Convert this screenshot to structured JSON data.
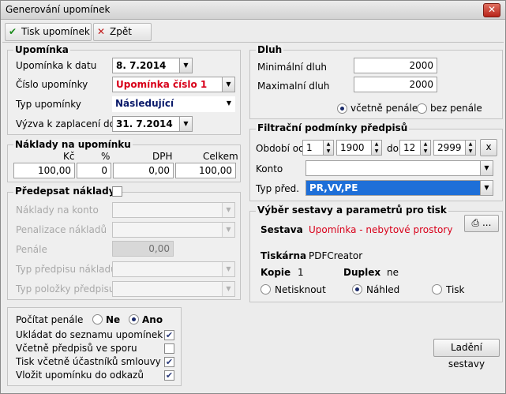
{
  "window": {
    "title": "Generování upomínek",
    "close": "✕"
  },
  "toolbar": {
    "print_label": "Tisk upomínek",
    "print_icon": "✔",
    "back_label": "Zpět",
    "back_icon": "✕"
  },
  "upominka": {
    "legend": "Upomínka",
    "date_label": "Upomínka k datu",
    "date_value": "8. 7.2014",
    "number_label": "Číslo upomínky",
    "number_value": "Upomínka číslo 1",
    "type_label": "Typ upomínky",
    "type_value": "Následující",
    "due_label": "Výzva k zaplacení do",
    "due_value": "31. 7.2014"
  },
  "naklady": {
    "legend": "Náklady na upomínku",
    "col_kc": "Kč",
    "col_pct": "%",
    "col_dph": "DPH",
    "col_celkem": "Celkem",
    "val_kc": "100,00",
    "val_pct": "0",
    "val_dph": "0,00",
    "val_celkem": "100,00"
  },
  "predepsat": {
    "legend": "Předepsat náklady",
    "konto_label": "Náklady na konto",
    "penal_label": "Penalizace nákladů",
    "penale_label": "Penále",
    "penale_value": "0,00",
    "typ_predpisu_label": "Typ předpisu nákladu",
    "typ_polozky_label": "Typ položky předpisu"
  },
  "options": {
    "pocitat_label": "Počítat penále",
    "ne_label": "Ne",
    "ano_label": "Ano",
    "ukladat_label": "Ukládat do seznamu upomínek",
    "ukladat": true,
    "vcetne_spor_label": "Včetně předpisů ve sporu",
    "vcetne_spor": false,
    "tisk_ucastniku_label": "Tisk včetně účastníků smlouvy",
    "tisk_ucastniku": true,
    "odkazy_label": "Vložit upomínku do odkazů",
    "odkazy": true
  },
  "dluh": {
    "legend": "Dluh",
    "min_label": "Minimální dluh",
    "min_value": "2000",
    "max_label": "Maximalní dluh",
    "max_value": "2000",
    "incl_label": "včetně penále",
    "excl_label": "bez penále"
  },
  "filtr": {
    "legend": "Filtrační podmínky předpisů",
    "period_label": "Období od",
    "from_month": "1",
    "from_year": "1900",
    "to_label": "do",
    "to_month": "12",
    "to_year": "2999",
    "clear": "x",
    "konto_label": "Konto",
    "typ_label": "Typ před.",
    "typ_value": "PR,VV,PE"
  },
  "sestava": {
    "legend": "Výběr sestavy a parametrů pro tisk",
    "sestava_label": "Sestava",
    "sestava_value": "Upomínka - nebytové prostory",
    "printer_btn": "...",
    "tiskarna_label": "Tiskárna",
    "tiskarna_value": "PDFCreator",
    "kopie_label": "Kopie",
    "kopie_value": "1",
    "duplex_label": "Duplex",
    "duplex_value": "ne",
    "netisknout_label": "Netisknout",
    "nahled_label": "Náhled",
    "tisk_label": "Tisk",
    "ladeni_label": "Ladění sestavy"
  },
  "colors": {
    "accent_red": "#d8001a",
    "accent_navy": "#0a1a6a",
    "selection": "#1e6fd8"
  }
}
